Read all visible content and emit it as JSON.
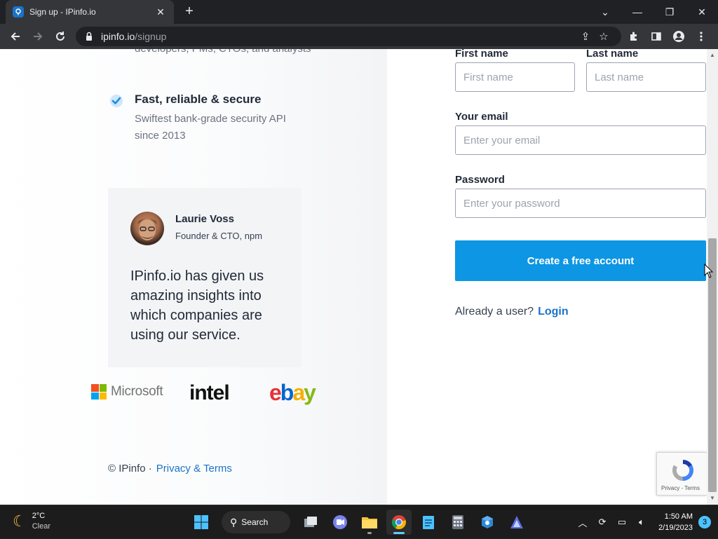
{
  "browser": {
    "tab_title": "Sign up - IPinfo.io",
    "url_host": "ipinfo.io",
    "url_path": "/signup"
  },
  "left": {
    "feature_cont": "developers, PMs, CTOs, and analysts",
    "feature_title": "Fast, reliable & secure",
    "feature_desc": "Swiftest bank-grade security API since 2013",
    "testimonial": {
      "name": "Laurie Voss",
      "role": "Founder & CTO, npm",
      "quote": "IPinfo.io has given us amazing insights into which companies are using our service."
    },
    "logos": {
      "microsoft": "Microsoft",
      "intel": "intel",
      "ebay": [
        "e",
        "b",
        "a",
        "y"
      ]
    },
    "footer": {
      "copyright": "© IPinfo ·",
      "link": "Privacy & Terms"
    }
  },
  "form": {
    "first_name_label": "First name",
    "first_name_placeholder": "First name",
    "last_name_label": "Last name",
    "last_name_placeholder": "Last name",
    "email_label": "Your email",
    "email_placeholder": "Enter your email",
    "password_label": "Password",
    "password_placeholder": "Enter your password",
    "submit_label": "Create a free account",
    "already_text": "Already a user?",
    "login_label": "Login"
  },
  "recaptcha": {
    "text": "Privacy - Terms"
  },
  "taskbar": {
    "temperature": "2°C",
    "condition": "Clear",
    "search_label": "Search",
    "time": "1:50 AM",
    "date": "2/19/2023",
    "notification_count": "3"
  },
  "colors": {
    "accent": "#0d96e4",
    "link": "#1a73c8"
  }
}
